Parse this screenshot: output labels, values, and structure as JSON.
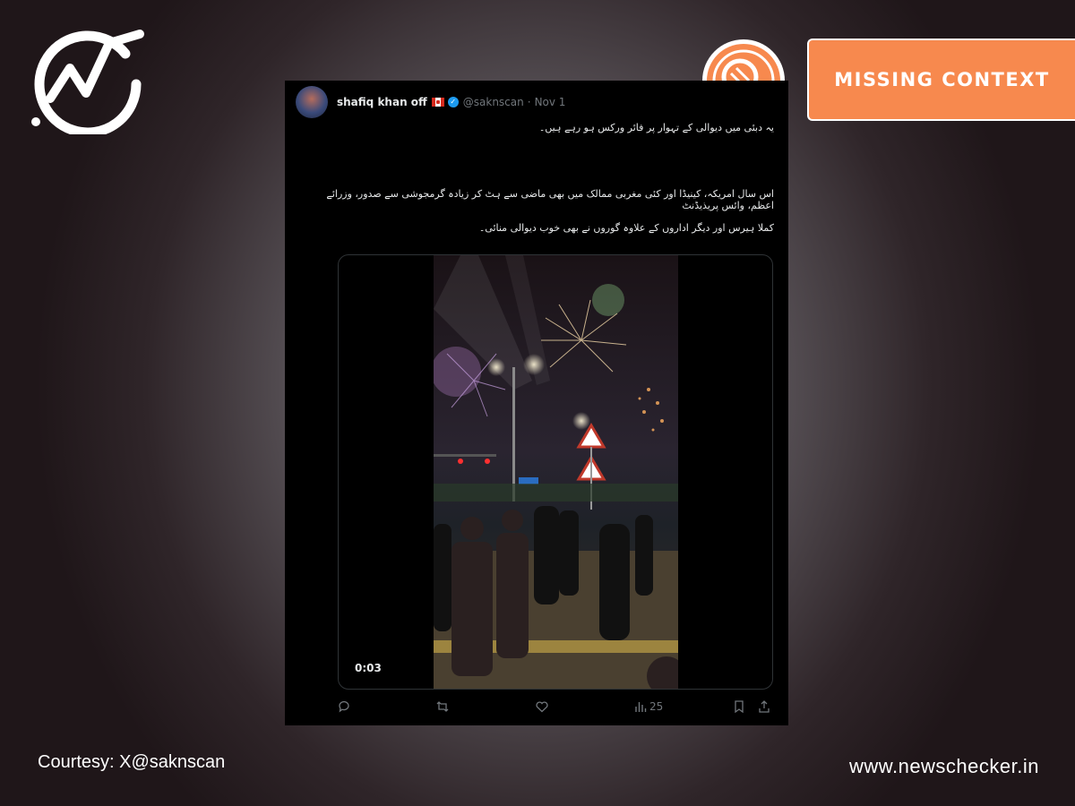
{
  "brand": {
    "logo_icon": "checkmark-chart-logo",
    "stamp_icon": "magnifier-stamp-icon",
    "verdict_label": "MISSING CONTEXT",
    "verdict_color": "#f7894e",
    "website": "www.newschecker.in",
    "courtesy": "Courtesy: X@saknscan"
  },
  "tweet": {
    "author_name": "shafiq khan off",
    "flag_icon": "canada-flag-icon",
    "verified_icon": "verified-badge-icon",
    "handle": "@saknscan",
    "separator": "·",
    "date": "Nov 1",
    "text_line_1": "یہ دبئی میں دیوالی کے تہوار پر فائر ورکس ہو رہے ہیں۔",
    "text_line_2": "اس سال امریکہ، کینیڈا اور کئی مغربی ممالک میں بھی ماضی سے ہٹ کر زیادہ گرمجوشی سے صدور، وزرائے اعظم، وائس پریذیڈنٹ",
    "text_line_3": "کملا ہیرس اور دیگر اداروں کے علاوہ گوروں نے بھی خوب دیوالی منائی۔",
    "video_time": "0:03",
    "views": "25",
    "action_icons": [
      "reply-icon",
      "retweet-icon",
      "like-icon",
      "views-icon",
      "bookmark-icon",
      "share-icon"
    ]
  }
}
